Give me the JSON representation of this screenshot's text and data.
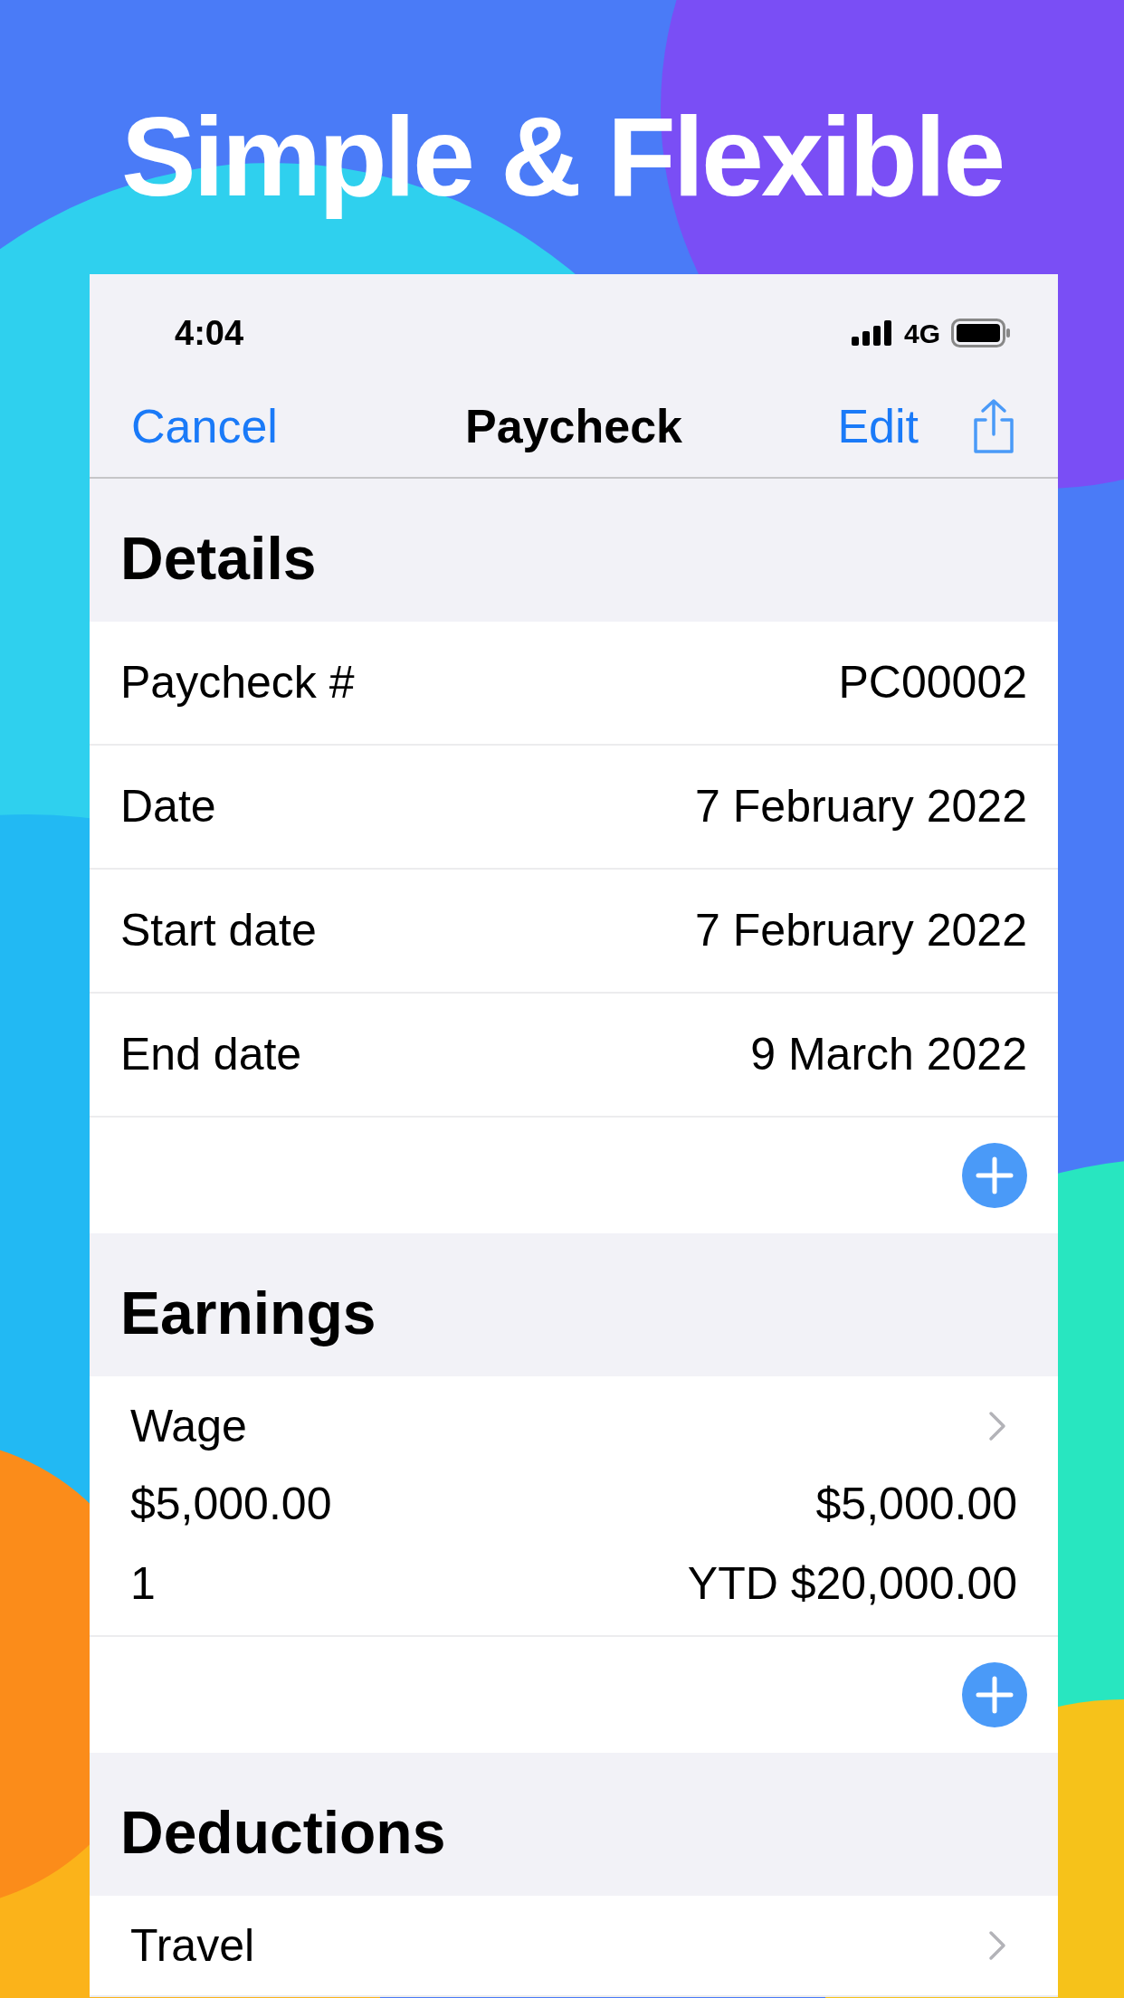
{
  "headline": "Simple & Flexible",
  "status_bar": {
    "time": "4:04",
    "network": "4G"
  },
  "nav": {
    "left": "Cancel",
    "title": "Paycheck",
    "right": "Edit"
  },
  "sections": [
    {
      "title": "Details",
      "kind": "fields",
      "add": true,
      "rows": [
        {
          "label": "Paycheck #",
          "value": "PC00002"
        },
        {
          "label": "Date",
          "value": "7 February 2022"
        },
        {
          "label": "Start date",
          "value": "7 February 2022"
        },
        {
          "label": "End date",
          "value": "9 March 2022"
        }
      ]
    },
    {
      "title": "Earnings",
      "kind": "items",
      "add": true,
      "items": [
        {
          "name": "Wage",
          "rate": "$5,000.00",
          "amount": "$5,000.00",
          "quantity": "1",
          "ytd": "YTD $20,000.00"
        }
      ]
    },
    {
      "title": "Deductions",
      "kind": "items",
      "add": false,
      "items": [
        {
          "name": "Travel"
        }
      ]
    }
  ]
}
